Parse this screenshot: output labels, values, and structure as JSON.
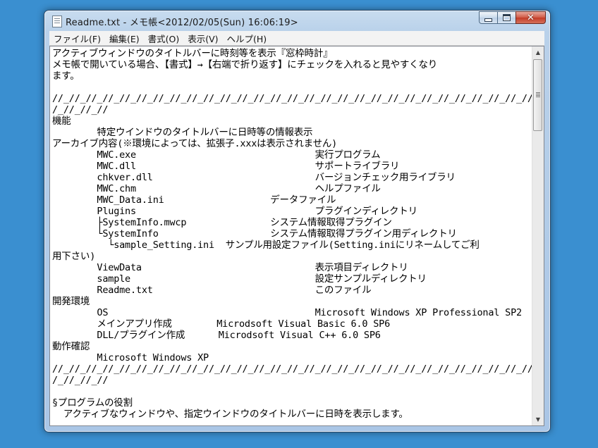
{
  "window": {
    "title": "Readme.txt - メモ帳<2012/02/05(Sun) 16:06:19>"
  },
  "menu": {
    "items": [
      "ファイル(F)",
      "編集(E)",
      "書式(O)",
      "表示(V)",
      "ヘルプ(H)"
    ]
  },
  "editor": {
    "lines": [
      "アクティブウィンドウのタイトルバーに時刻等を表示『窓枠時計』",
      "メモ帳で開いている場合、【書式】→【右端で折り返す】にチェックを入れると見やすくなり",
      "ます。",
      "",
      "//_//_//_//_//_//_//_//_//_//_//_//_//_//_//_//_//_//_//_//_//_//_//_//_//_//_//_//_//_//",
      "/_//_//_//",
      "機能",
      "        特定ウインドウのタイトルバーに日時等の情報表示",
      "アーカイブ内容(※環境によっては、拡張子.xxxは表示されません)",
      "        MWC.exe                                実行プログラム",
      "        MWC.dll                                サポートライブラリ",
      "        chkver.dll                             バージョンチェック用ライブラリ",
      "        MWC.chm                                ヘルプファイル",
      "        MWC_Data.ini                   データファイル",
      "        Plugins                                プラグインディレクトリ",
      "        ├SystemInfo.mwcp               システム情報取得プラグイン",
      "        └SystemInfo                    システム情報取得プラグイン用ディレクトリ",
      "          └sample_Setting.ini  サンプル用設定ファイル(Setting.iniにリネームしてご利",
      "用下さい)",
      "        ViewData                               表示項目ディレクトリ",
      "        sample                                 設定サンプルディレクトリ",
      "        Readme.txt                             このファイル",
      "開発環境",
      "        OS                                     Microsoft Windows XP Professional SP2",
      "        メインアプリ作成        Microdsoft Visual Basic 6.0 SP6",
      "        DLL/プラグイン作成      Microdsoft Visual C++ 6.0 SP6",
      "動作確認",
      "        Microsoft Windows XP",
      "//_//_//_//_//_//_//_//_//_//_//_//_//_//_//_//_//_//_//_//_//_//_//_//_//_//_//_//_//_//",
      "/_//_//_//",
      "",
      "§プログラムの役割",
      "  アクティブなウィンドウや、指定ウインドウのタイトルバーに日時を表示します。"
    ]
  },
  "icons": {
    "app": "notepad-icon",
    "minimize": "minimize-icon",
    "maximize": "maximize-icon",
    "close": "close-icon",
    "scroll_up": "scroll-up-arrow-icon",
    "scroll_down": "scroll-down-arrow-icon"
  }
}
